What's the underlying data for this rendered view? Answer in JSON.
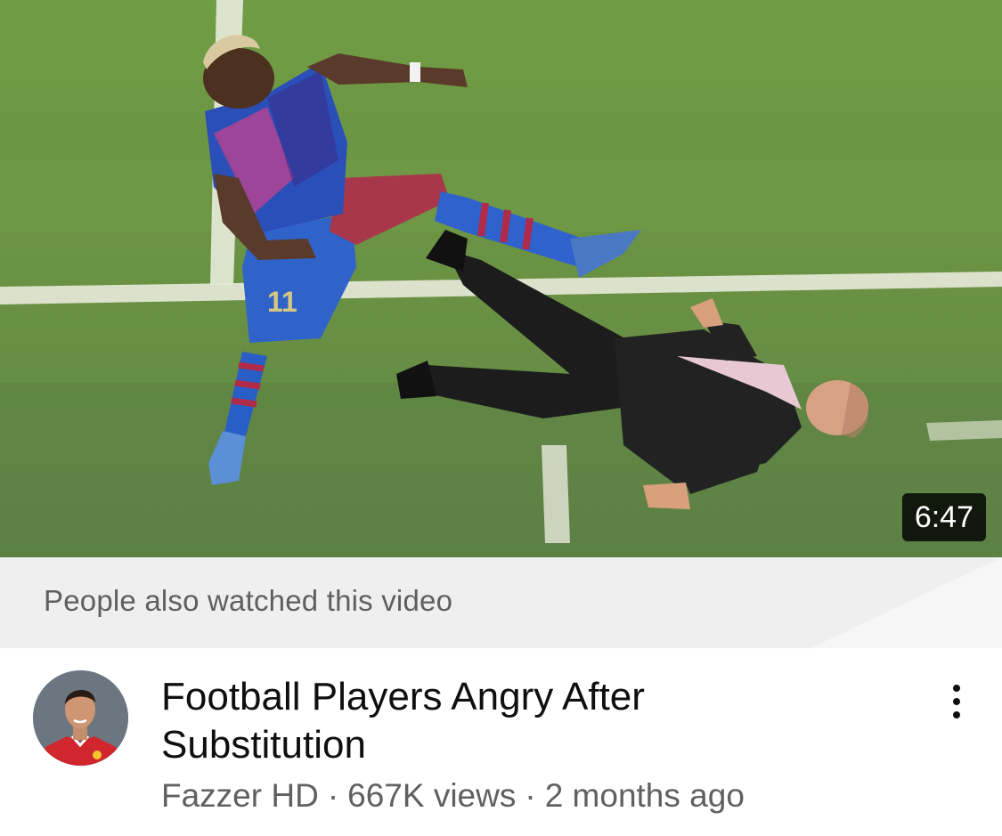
{
  "video": {
    "duration": "6:47",
    "title": "Football Players Angry After Substitution",
    "channel": "Fazzer HD",
    "views": "667K views",
    "age": "2 months ago",
    "separator": "·"
  },
  "recommendation_banner": {
    "text": "People also watched this video"
  },
  "icons": {
    "more": "more-vertical-icon",
    "avatar": "channel-avatar"
  },
  "colors": {
    "banner_bg": "#efefef",
    "title": "#0f0f0f",
    "meta": "#606060",
    "duration_bg": "#000000"
  }
}
